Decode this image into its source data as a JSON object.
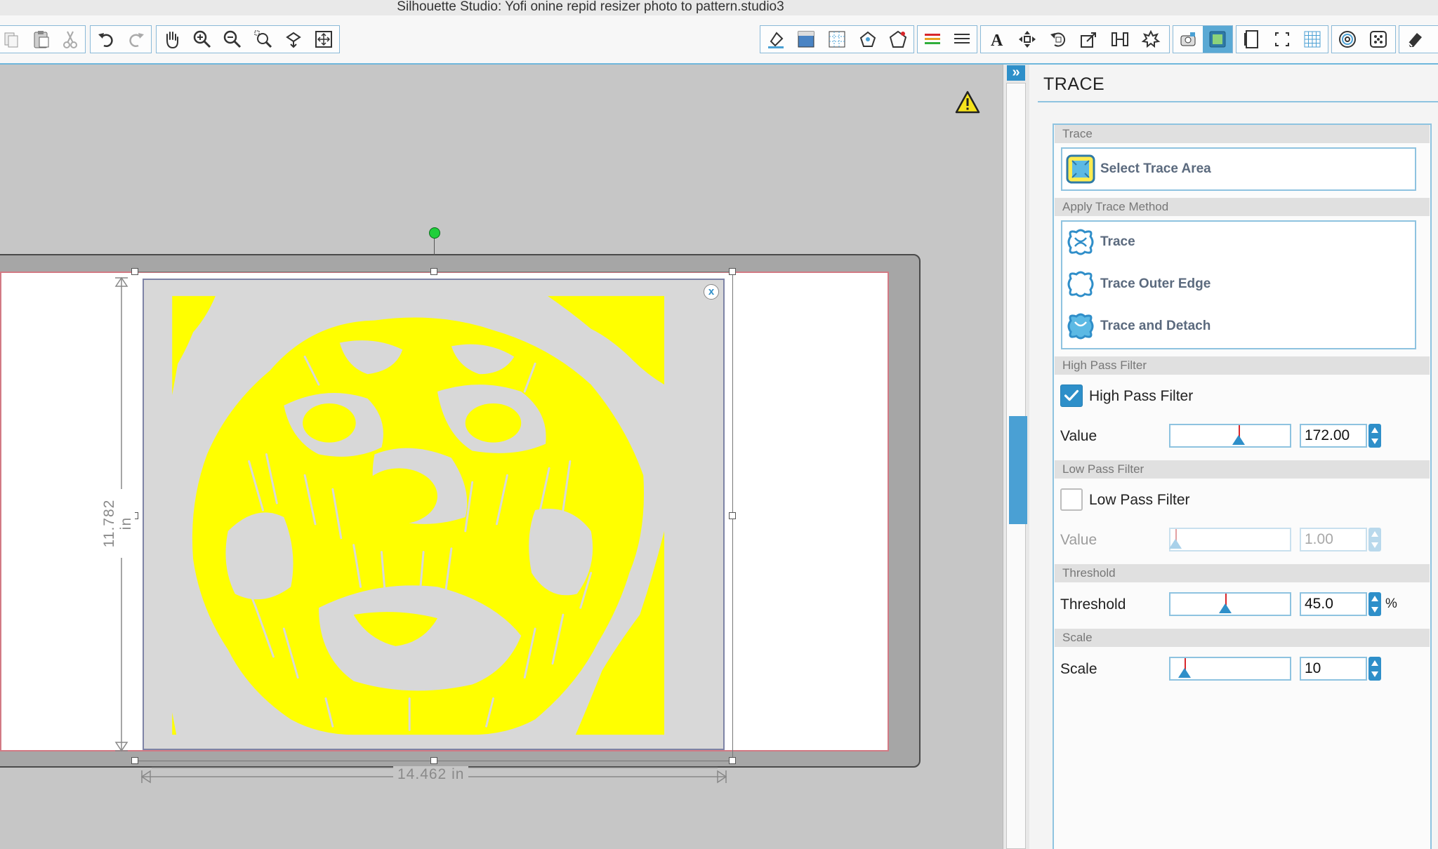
{
  "window": {
    "title": "Silhouette Studio: Yofi onine repid resizer photo to pattern.studio3"
  },
  "toolbar": {
    "groups": [
      {
        "name": "clipboard",
        "tools": [
          "copy-icon",
          "paste-icon",
          "cut-icon"
        ]
      },
      {
        "name": "history",
        "tools": [
          "undo-icon",
          "redo-icon"
        ]
      },
      {
        "name": "navigation",
        "tools": [
          "pan-hand-icon",
          "zoom-in-icon",
          "zoom-out-icon",
          "zoom-select-icon",
          "zoom-drag-icon",
          "fit-page-icon"
        ]
      },
      {
        "name": "panels",
        "tools": [
          "fill-color-icon",
          "gradient-icon",
          "pattern-icon",
          "line-color-icon",
          "line-style-icon",
          "line-weight-icon",
          "text-style-icon"
        ]
      },
      {
        "name": "transform",
        "tools": [
          "text-icon",
          "move-icon",
          "rotate-icon",
          "scale-icon",
          "align-icon",
          "replicate-icon"
        ]
      },
      {
        "name": "trace",
        "tools": [
          "trace-icon",
          "trace-panel-icon"
        ]
      },
      {
        "name": "page",
        "tools": [
          "page-setup-icon",
          "cut-border-icon",
          "grid-icon"
        ]
      },
      {
        "name": "library",
        "tools": [
          "offset-icon",
          "media-icon",
          "eraser-icon"
        ]
      }
    ]
  },
  "canvas": {
    "width_label": "14.462 in",
    "height_label": "11.782 in",
    "close_label": "x",
    "warning_icon": "warning-triangle-icon",
    "artwork_color": "#ffff00"
  },
  "panel": {
    "expand_label": "»",
    "title": "TRACE",
    "trace_section": {
      "header": "Trace",
      "select_area_label": "Select Trace Area"
    },
    "apply_section": {
      "header": "Apply Trace Method",
      "methods": [
        "Trace",
        "Trace Outer Edge",
        "Trace and Detach"
      ]
    },
    "high_pass": {
      "header": "High Pass Filter",
      "checkbox_label": "High Pass Filter",
      "checked": true,
      "value_label": "Value",
      "value": "172.00"
    },
    "low_pass": {
      "header": "Low Pass Filter",
      "checkbox_label": "Low Pass Filter",
      "checked": false,
      "value_label": "Value",
      "value": "1.00"
    },
    "threshold": {
      "header": "Threshold",
      "label": "Threshold",
      "value": "45.0",
      "unit": "%"
    },
    "scale": {
      "header": "Scale",
      "label": "Scale",
      "value": "10"
    },
    "accent_color": "#2e8fc9"
  }
}
